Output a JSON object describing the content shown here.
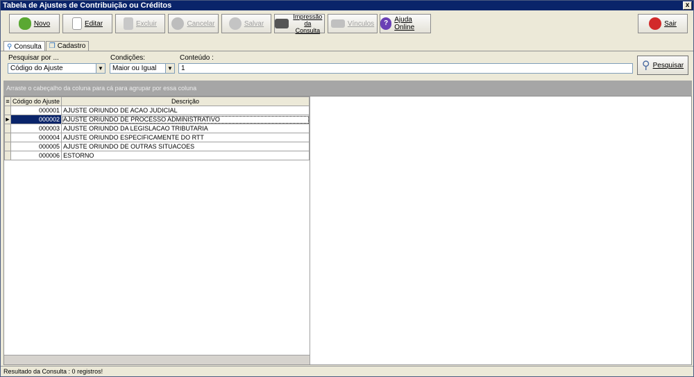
{
  "window": {
    "title": "Tabela de Ajustes de Contribuição ou Créditos",
    "close_glyph": "x"
  },
  "toolbar": {
    "novo": "Novo",
    "editar": "Editar",
    "excluir": "Excluir",
    "cancelar": "Cancelar",
    "salvar": "Salvar",
    "impressao_line1": "Impressão",
    "impressao_line2": "da Consulta",
    "vinculos": "Vínculos",
    "ajuda": "Ajuda Online",
    "sair": "Sair"
  },
  "tabs": [
    {
      "label": "Consulta"
    },
    {
      "label": "Cadastro"
    }
  ],
  "filters": {
    "pesquisar_label": "Pesquisar por ...",
    "pesquisar_value": "Código do Ajuste",
    "condicoes_label": "Condições:",
    "condicoes_value": "Maior ou Igual",
    "conteudo_label": "Conteúdo :",
    "conteudo_value": "1",
    "search_button": "Pesquisar"
  },
  "group_hint": "Arraste o cabeçalho da coluna para cá para agrupar por essa coluna",
  "grid": {
    "columns": [
      "Código do Ajuste",
      "Descrição"
    ],
    "rows": [
      {
        "code": "000001",
        "desc": "AJUSTE ORIUNDO DE ACAO JUDICIAL"
      },
      {
        "code": "000002",
        "desc": "AJUSTE ORIUNDO DE PROCESSO ADMINISTRATIVO"
      },
      {
        "code": "000003",
        "desc": "AJUSTE ORIUNDO DA LEGISLACAO TRIBUTARIA"
      },
      {
        "code": "000004",
        "desc": "AJUSTE ORIUNDO ESPECIFICAMENTE DO RTT"
      },
      {
        "code": "000005",
        "desc": "AJUSTE ORIUNDO DE OUTRAS SITUACOES"
      },
      {
        "code": "000006",
        "desc": "ESTORNO"
      }
    ],
    "selected_index": 1
  },
  "status": "Resultado da Consulta : 0 registros!",
  "colors": {
    "titlebar": "#0a246a",
    "selection": "#0a246a",
    "groupbar": "#a6a6a6"
  }
}
